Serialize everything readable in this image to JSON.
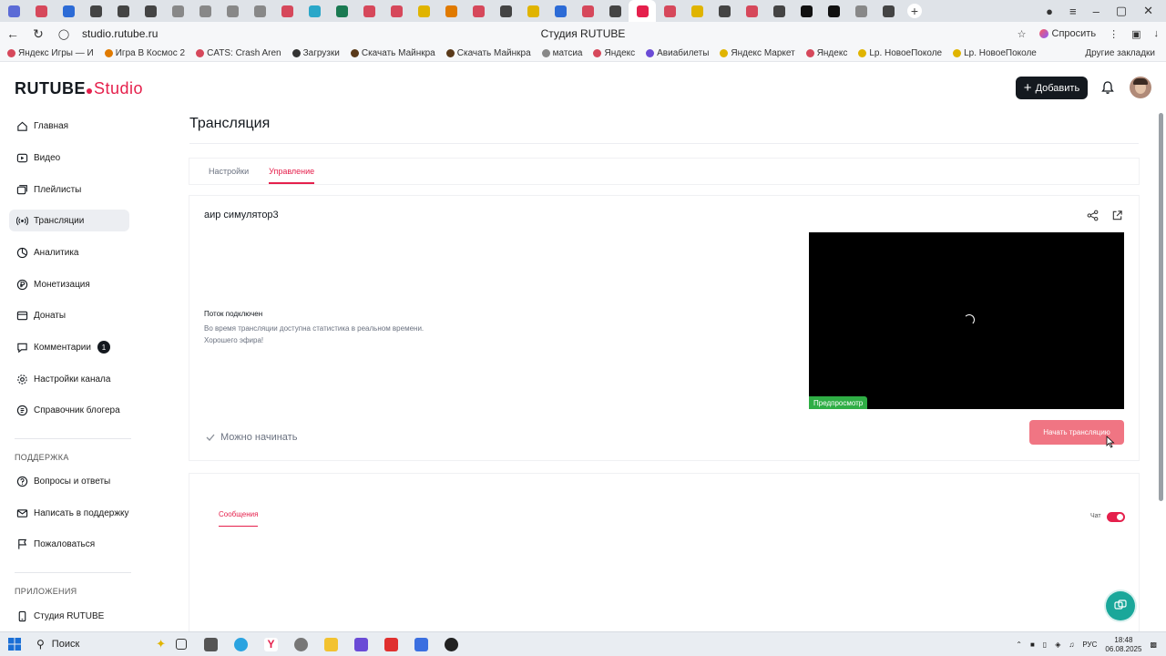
{
  "browser": {
    "url": "studio.rutube.ru",
    "window_title": "Студия RUTUBE",
    "ask_label": "Спросить",
    "tab_colors": [
      "#5b6bd6",
      "#d6485b",
      "#2c6bd6",
      "#444444",
      "#444444",
      "#444444",
      "#888888",
      "#888888",
      "#888888",
      "#888888",
      "#d6485b",
      "#2aa7c9",
      "#1a7a52",
      "#d6485b",
      "#d6485b",
      "#e0b400",
      "#e07a00",
      "#d6485b",
      "#444444",
      "#e0b400",
      "#2c6bd6",
      "#d6485b",
      "#444444",
      "#e5204c",
      "#d6485b",
      "#e0b400",
      "#444444",
      "#d6485b",
      "#444444",
      "#111111",
      "#111111",
      "#888888",
      "#444444"
    ],
    "bookmarks": [
      {
        "label": "Яндекс Игры — И",
        "color": "#d6485b"
      },
      {
        "label": "Игра В Космос 2",
        "color": "#e07a00"
      },
      {
        "label": "CATS: Crash Aren",
        "color": "#d6485b"
      },
      {
        "label": "Загрузки",
        "color": "#333333"
      },
      {
        "label": "Скачать Майнкра",
        "color": "#5a3a1a"
      },
      {
        "label": "Скачать Майнкра",
        "color": "#5a3a1a"
      },
      {
        "label": "матсиа",
        "color": "#888888"
      },
      {
        "label": "Яндекс",
        "color": "#d6485b"
      },
      {
        "label": "Авиабилеты",
        "color": "#6b4bd6"
      },
      {
        "label": "Яндекс Маркет",
        "color": "#e0b400"
      },
      {
        "label": "Яндекс",
        "color": "#d6485b"
      },
      {
        "label": "Lp. НовоеПоколе",
        "color": "#e0b400"
      },
      {
        "label": "Lp. НовоеПоколе",
        "color": "#e0b400"
      }
    ],
    "other_bookmarks": "Другие закладки"
  },
  "header": {
    "logo_main": "RUTUBE",
    "logo_sub": "Studio",
    "add_button": "Добавить"
  },
  "sidebar": {
    "items": [
      {
        "label": "Главная",
        "icon": "home-icon"
      },
      {
        "label": "Видео",
        "icon": "video-icon"
      },
      {
        "label": "Плейлисты",
        "icon": "playlist-icon"
      },
      {
        "label": "Трансляции",
        "icon": "broadcast-icon",
        "active": true
      },
      {
        "label": "Аналитика",
        "icon": "analytics-icon"
      },
      {
        "label": "Монетизация",
        "icon": "ruble-icon"
      },
      {
        "label": "Донаты",
        "icon": "donate-icon"
      },
      {
        "label": "Комментарии",
        "icon": "comment-icon",
        "badge": "1"
      },
      {
        "label": "Настройки канала",
        "icon": "settings-icon"
      },
      {
        "label": "Справочник блогера",
        "icon": "book-icon"
      }
    ],
    "support_title": "ПОДДЕРЖКА",
    "support_items": [
      {
        "label": "Вопросы и ответы",
        "icon": "question-icon"
      },
      {
        "label": "Написать в поддержку",
        "icon": "mail-icon"
      },
      {
        "label": "Пожаловаться",
        "icon": "flag-icon"
      }
    ],
    "apps_title": "ПРИЛОЖЕНИЯ",
    "apps_items": [
      {
        "label": "Студия RUTUBE",
        "icon": "phone-icon"
      }
    ]
  },
  "main": {
    "title": "Трансляция",
    "tabs": [
      {
        "label": "Настройки",
        "active": false
      },
      {
        "label": "Управление",
        "active": true
      }
    ],
    "stream": {
      "name": "аир симулятор3",
      "status_title": "Поток подключен",
      "status_line1": "Во время трансляции доступна статистика в реальном времени.",
      "status_line2": "Хорошего эфира!",
      "preview_label": "Предпросмотр",
      "ready_label": "Можно начинать",
      "start_button": "Начать трансляцию"
    },
    "chat": {
      "tab_label": "Сообщения",
      "toggle_label": "Чат",
      "enabled": true
    }
  },
  "taskbar": {
    "search_placeholder": "Поиск",
    "language": "РУС",
    "time": "18:48",
    "date": "06.08.2025"
  },
  "colors": {
    "accent": "#e5204c",
    "dark": "#14191f",
    "preview_green": "#2fae45",
    "help_teal": "#1aa79a"
  }
}
